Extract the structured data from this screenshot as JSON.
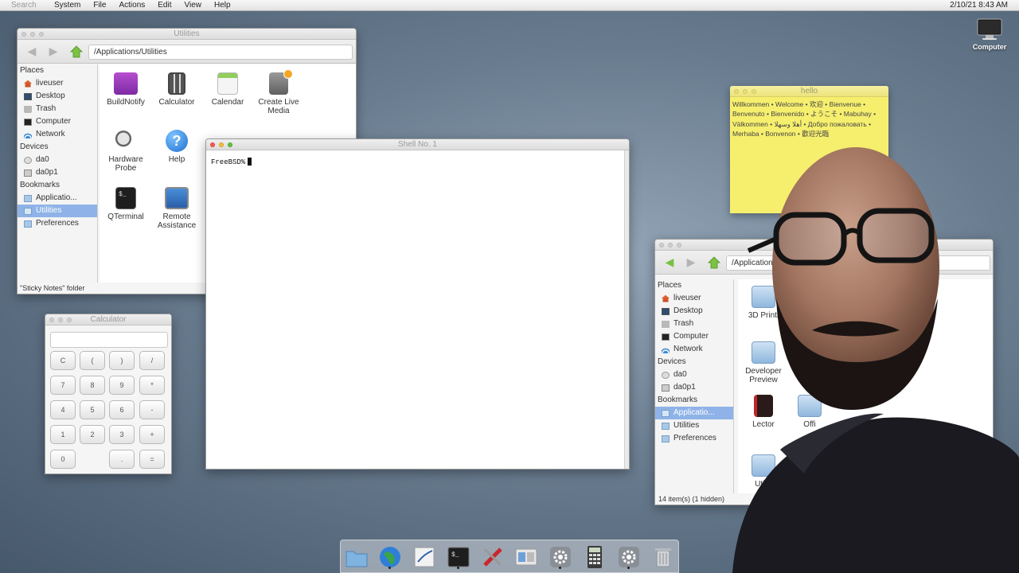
{
  "menubar": {
    "search_placeholder": "Search",
    "menus": [
      "System",
      "File",
      "Actions",
      "Edit",
      "View",
      "Help"
    ],
    "clock": "2/10/21 8:43 AM"
  },
  "desktop": {
    "computer_label": "Computer"
  },
  "utilities_window": {
    "title": "Utilities",
    "path": "/Applications/Utilities",
    "sidebar": {
      "places_header": "Places",
      "places": [
        "liveuser",
        "Desktop",
        "Trash",
        "Computer",
        "Network"
      ],
      "devices_header": "Devices",
      "devices": [
        "da0",
        "da0p1"
      ],
      "bookmarks_header": "Bookmarks",
      "bookmarks": [
        "Applicatio...",
        "Utilities",
        "Preferences"
      ],
      "selected": "Utilities"
    },
    "apps": [
      "BuildNotify",
      "Calculator",
      "Calendar",
      "Create Live Media",
      "Hardware Probe",
      "Help",
      "QTerminal",
      "Remote Assistance"
    ],
    "status": "\"Sticky Notes\" folder"
  },
  "calculator": {
    "title": "Calculator",
    "keys": [
      "C",
      "(",
      ")",
      "/",
      "7",
      "8",
      "9",
      "*",
      "4",
      "5",
      "6",
      "-",
      "1",
      "2",
      "3",
      "+",
      "0",
      ".",
      "="
    ]
  },
  "shell": {
    "title": "Shell No. 1",
    "prompt": "FreeBSD%"
  },
  "sticky": {
    "title": "hello",
    "text": "Willkommen • Welcome • 欢迎 • Bienvenue • Benvenuto • Bienvenido • ようこそ • Mabuhay • Välkommen • أهلا وسهلا • Добро пожаловать • Merhaba • Bonvenon • 歡迎光臨"
  },
  "applications_window": {
    "path": "/Applications",
    "sidebar": {
      "places_header": "Places",
      "places": [
        "liveuser",
        "Desktop",
        "Trash",
        "Computer",
        "Network"
      ],
      "devices_header": "Devices",
      "devices": [
        "da0",
        "da0p1"
      ],
      "bookmarks_header": "Bookmarks",
      "bookmarks": [
        "Applicatio...",
        "Utilities",
        "Preferences"
      ],
      "selected": "Applicatio..."
    },
    "items": [
      "3D Printi",
      "Developer Preview",
      "Lector",
      "Offi",
      "Utiliti"
    ],
    "status": "14 item(s) (1 hidden)"
  },
  "dock": {
    "items": [
      "folder-icon",
      "globe-icon",
      "text-editor-icon",
      "terminal-icon",
      "utilities-icon",
      "windows-icon",
      "settings-icon",
      "calculator-icon",
      "settings-icon",
      "trash-icon"
    ]
  },
  "colors": {
    "selection": "#8fb3e8",
    "sticky": "#f6ef6e",
    "desktop": "#6a7d90"
  }
}
